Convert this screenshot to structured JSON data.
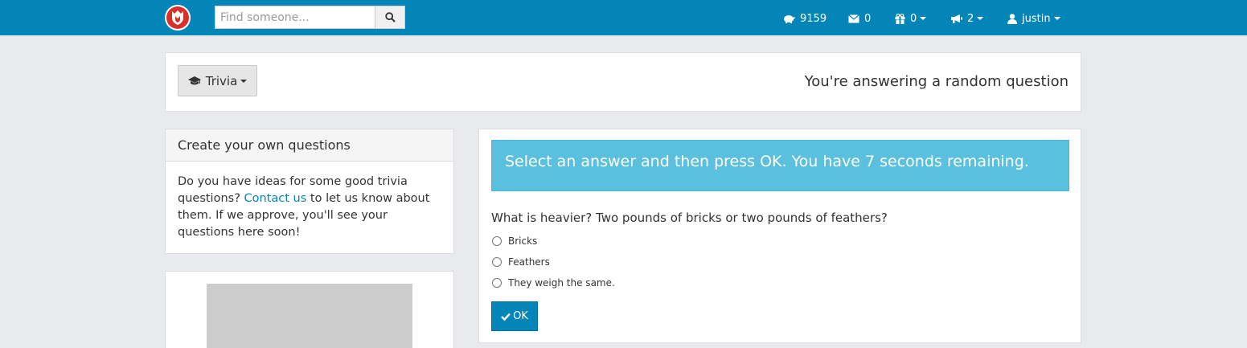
{
  "colors": {
    "navbar": "#0385b8",
    "logo": "#d9302c",
    "alert": "#5bc0de",
    "link": "#0385b8"
  },
  "navbar": {
    "search_placeholder": "Find someone...",
    "items": [
      {
        "icon": "piggy-bank-icon",
        "value": "9159"
      },
      {
        "icon": "envelope-icon",
        "value": "0"
      },
      {
        "icon": "gift-icon",
        "value": "0"
      },
      {
        "icon": "bullhorn-icon",
        "value": "2"
      },
      {
        "icon": "user-icon",
        "value": "justin"
      }
    ]
  },
  "top": {
    "trivia_label": "Trivia",
    "heading": "You're answering a random question"
  },
  "create": {
    "title": "Create your own questions",
    "text_before": "Do you have ideas for some good trivia questions? ",
    "link": "Contact us",
    "text_after": " to let us know about them. If we approve, you'll see your questions here soon!"
  },
  "quiz": {
    "alert": "Select an answer and then press OK. You have 7 seconds remaining.",
    "question": "What is heavier? Two pounds of bricks or two pounds of feathers?",
    "options": [
      "Bricks",
      "Feathers",
      "They weigh the same."
    ],
    "ok_label": "OK"
  }
}
